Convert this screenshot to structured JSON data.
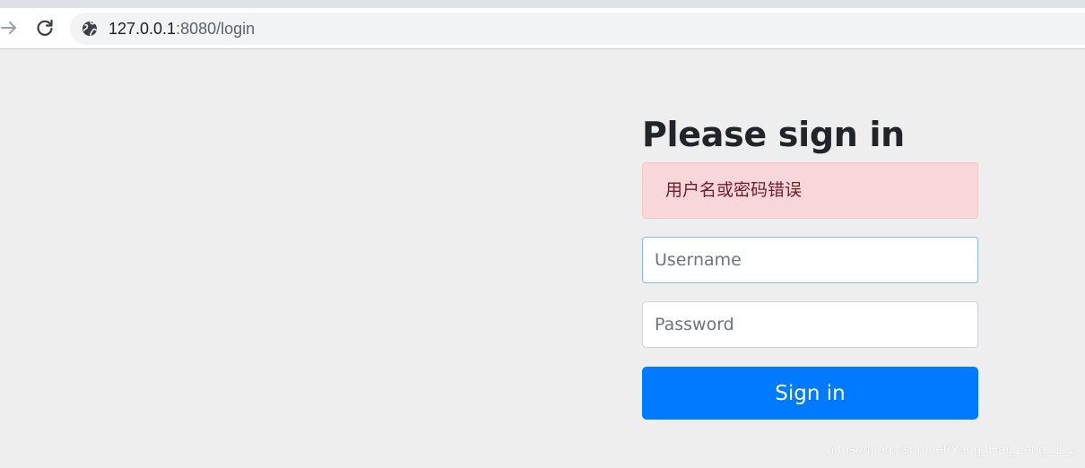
{
  "browser": {
    "url_host": "127.0.0.1",
    "url_path": ":8080/login",
    "forward_icon": "arrow-right-icon",
    "reload_icon": "reload-icon",
    "site_icon": "globe-icon"
  },
  "login": {
    "heading": "Please sign in",
    "error_message": "用户名或密码错误",
    "username_placeholder": "Username",
    "password_placeholder": "Password",
    "submit_label": "Sign in"
  },
  "watermark": "https://blog.csdn.net/Yang_Hai_Long_1_2",
  "colors": {
    "primary": "#007bff",
    "alert_bg": "#f8d7da",
    "alert_text": "#721c24",
    "page_bg": "#eeeeee"
  }
}
